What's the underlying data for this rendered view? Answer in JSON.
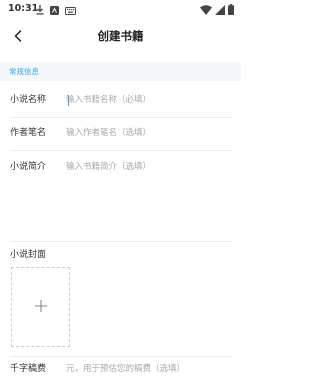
{
  "status_bar": {
    "time": "10:31",
    "left_icons": [
      "download-icon",
      "app-badge-icon",
      "keyboard-icon"
    ],
    "right_icons": [
      "wifi-icon",
      "cellular-signal-icon",
      "battery-icon"
    ]
  },
  "nav": {
    "title": "创建书籍",
    "back_icon": "chevron-left-icon"
  },
  "section": {
    "header": "常规信息"
  },
  "form": {
    "title_label": "小说名称",
    "title_placeholder": "输入书籍名称（必填）",
    "author_label": "作者笔名",
    "author_placeholder": "输入作者笔名（选填）",
    "intro_label": "小说简介",
    "intro_placeholder": "输入书籍简介（选填）",
    "cover_label": "小说封面",
    "fee_label": "千字稿费",
    "fee_placeholder": "元，用于预估您的稿费（选填）"
  },
  "colors": {
    "accent": "#36a3e6",
    "section_bg": "#f6f7f9",
    "placeholder": "#a8a8a8",
    "divider": "#ececec"
  }
}
